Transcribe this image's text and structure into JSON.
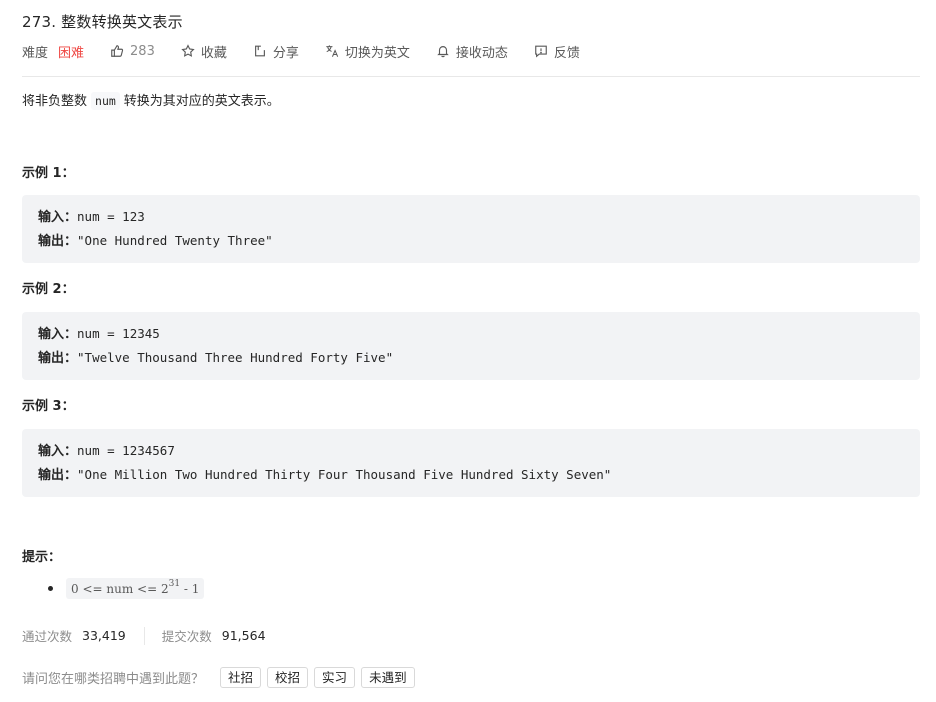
{
  "problem": {
    "title": "273. 整数转换英文表示"
  },
  "toolbar": {
    "difficulty_label": "难度",
    "difficulty_value": "困难",
    "likes": "283",
    "favorite": "收藏",
    "share": "分享",
    "switch_lang": "切换为英文",
    "subscribe": "接收动态",
    "feedback": "反馈"
  },
  "description": {
    "prefix": "将非负整数",
    "code": "num",
    "suffix": "转换为其对应的英文表示。"
  },
  "examples": [
    {
      "title": "示例 1：",
      "input_label": "输入：",
      "input": "num = 123",
      "output_label": "输出：",
      "output": "\"One Hundred Twenty Three\""
    },
    {
      "title": "示例 2：",
      "input_label": "输入：",
      "input": "num = 12345",
      "output_label": "输出：",
      "output": "\"Twelve Thousand Three Hundred Forty Five\""
    },
    {
      "title": "示例 3：",
      "input_label": "输入：",
      "input": "num = 1234567",
      "output_label": "输出：",
      "output": "\"One Million Two Hundred Thirty Four Thousand Five Hundred Sixty Seven\""
    }
  ],
  "hints": {
    "title": "提示：",
    "constraint_prefix": "0 <= num <= 2",
    "constraint_exp": "31",
    "constraint_suffix": " - 1"
  },
  "stats": {
    "accepted_label": "通过次数",
    "accepted_value": "33,419",
    "submitted_label": "提交次数",
    "submitted_value": "91,564"
  },
  "survey": {
    "question": "请问您在哪类招聘中遇到此题？",
    "options": [
      "社招",
      "校招",
      "实习",
      "未遇到"
    ]
  },
  "colors": {
    "difficulty_hard": "#ef4743",
    "example_bg": "#f2f3f5",
    "muted_text": "#8c8c8c"
  },
  "icons": {
    "likes": "thumbs-up-icon",
    "favorite": "star-icon",
    "share": "share-icon",
    "switch_lang": "translate-icon",
    "subscribe": "bell-icon",
    "feedback": "feedback-icon"
  }
}
